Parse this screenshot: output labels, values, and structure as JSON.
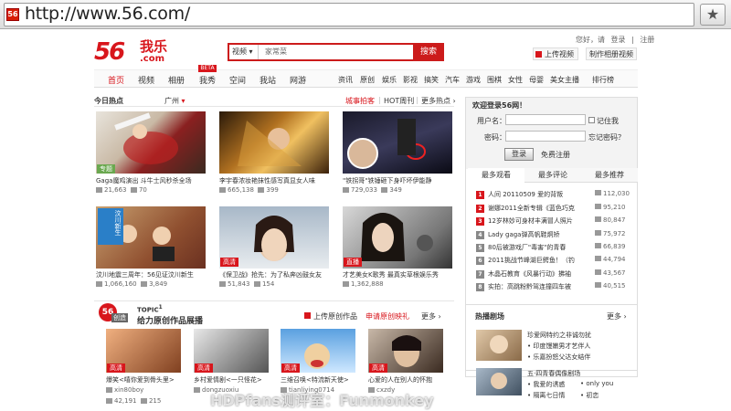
{
  "browser": {
    "url": "http://www.56.com/",
    "favicon": "56"
  },
  "header": {
    "logo_main": "56",
    "logo_cn": "我乐",
    "logo_com": ".com",
    "search_category": "视频",
    "search_placeholder": "家常菜",
    "search_button": "搜索",
    "toplinks": [
      "您好，请",
      "登录",
      "|",
      "注册"
    ],
    "upload_label": "上传视频",
    "make_label": "制作相册视频"
  },
  "nav": {
    "main": [
      "首页",
      "视频",
      "相册",
      "我秀",
      "空间",
      "我站",
      "网游"
    ],
    "beta": "BETA",
    "sub": [
      "资讯",
      "原创",
      "娱乐",
      "影视",
      "搞笑",
      "汽车",
      "游戏",
      "围棋",
      "女性",
      "母婴",
      "美女主播",
      "排行榜"
    ]
  },
  "hot": {
    "title": "今日热点",
    "city": "广州",
    "tabs": [
      "城事拍客",
      "|",
      "HOT周刊",
      "|",
      "更多热点 ›"
    ],
    "items": [
      {
        "caption": "Gaga魔鸡演出 斗牛士风秒杀全场",
        "views": "21,663",
        "comments": "70",
        "tag": "专题",
        "tag_color": "#6aa84f",
        "thumb": "gaga-stage-thumbnail"
      },
      {
        "caption": "李宇春浓妆艳抹性感写真显女人味",
        "views": "665,138",
        "comments": "399",
        "tag": "",
        "tag_color": "",
        "thumb": "liyuchun-photo-thumbnail"
      },
      {
        "caption": "\"铁拐哥\"铁锤砸下身吓坏伊能静",
        "views": "729,033",
        "comments": "349",
        "tag": "",
        "tag_color": "",
        "thumb": "tieguaige-stage-thumbnail"
      },
      {
        "caption": "汶川地震三周年：56见证汶川新生",
        "views": "1,066,160",
        "comments": "3,849",
        "tag": "",
        "tag_color": "",
        "banner": "汶川新生",
        "thumb": "wenchuan-thumbnail"
      },
      {
        "caption": "《保卫战》抢先：为了私奔凶鼓女友",
        "views": "51,843",
        "comments": "154",
        "tag": "高清",
        "tag_color": "#d8161c",
        "thumb": "girl-closeup-thumbnail"
      },
      {
        "caption": "才艺美女K歌秀 最真实草根娱乐秀",
        "views": "1,362,888",
        "comments": "",
        "tag": "直播",
        "tag_color": "#d8161c",
        "thumb": "karaoke-girl-thumbnail"
      }
    ]
  },
  "topic": {
    "label": "TOPIC",
    "num": "1",
    "badge": "56",
    "badge_sub": "创造",
    "title": "给力原创作品展播",
    "actions": [
      "上传原创作品",
      "申请原创映礼",
      "更多 ›"
    ],
    "items": [
      {
        "caption": "爆笑<嘻你爱到骨头里>",
        "user": "xin80boy",
        "views": "42,191",
        "comments": "215",
        "tag": "高清"
      },
      {
        "caption": "乡村爱情剧<一只怪花>",
        "user": "dongzuoxiu",
        "views": "",
        "comments": "",
        "tag": "高清"
      },
      {
        "caption": "三维召唤<特流新天使>",
        "user": "tianliying0714",
        "views": "",
        "comments": "",
        "tag": "高清"
      },
      {
        "caption": "心爱的人在别人的怀抱",
        "user": "cxzdy",
        "views": "",
        "comments": "",
        "tag": "高清"
      }
    ]
  },
  "login": {
    "title": "欢迎登录56网！",
    "user_label": "用户名：",
    "pass_label": "密码：",
    "remember": "记住我",
    "forgot": "忘记密码？",
    "button": "登录",
    "register": "免费注册"
  },
  "ranking": {
    "tabs": [
      "最多观看",
      "最多评论",
      "最多推荐"
    ],
    "items": [
      {
        "n": "1",
        "title": "人间 20110509 爱的背叛",
        "count": "112,030",
        "color": "#d8161c"
      },
      {
        "n": "2",
        "title": "谢娜2011全新专辑《蓝色巧克",
        "count": "95,210",
        "color": "#d8161c"
      },
      {
        "n": "3",
        "title": "12岁林妙可身材丰满冒人照片",
        "count": "80,847",
        "color": "#d8161c"
      },
      {
        "n": "4",
        "title": "Lady gaga弹高帆鞋炯矫",
        "count": "75,972",
        "color": "#888888"
      },
      {
        "n": "5",
        "title": "80后被游戏厂\"毒害\"的青春",
        "count": "66,839",
        "color": "#888888"
      },
      {
        "n": "6",
        "title": "2011挑战节峰湖巨鳄鱼！（钓",
        "count": "44,794",
        "color": "#888888"
      },
      {
        "n": "7",
        "title": "木晶石教育《风暴行动》拂袖",
        "count": "43,567",
        "color": "#888888"
      },
      {
        "n": "8",
        "title": "实拍：高跳粉黔驾连撞四车被",
        "count": "40,515",
        "color": "#888888"
      }
    ]
  },
  "drama": {
    "title": "热播剧场",
    "more": "更多 ›",
    "items": [
      {
        "title": "珍爱网特约之非诚勿扰",
        "lines": [
          "印度馒嫩男才艺伴人",
          "乐嘉扮怒父达女结伴"
        ]
      },
      {
        "title": "五·四青春偶像剧场",
        "lines": [
          "我爱的诱惑",
          "only you",
          "隔离七日情",
          "初恋"
        ]
      }
    ]
  },
  "watermark": "HDPfans测评室：Funmonkey"
}
